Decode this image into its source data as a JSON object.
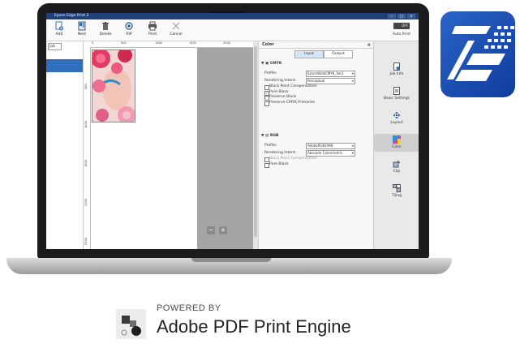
{
  "window": {
    "title": "Epson Edge Print 2",
    "controls": [
      "–",
      "□",
      "×"
    ]
  },
  "toolbar": {
    "buttons": [
      {
        "label": "Add",
        "icon": "add-file-icon"
      },
      {
        "label": "Nest",
        "icon": "nest-icon"
      },
      {
        "label": "Delete",
        "icon": "trash-icon"
      },
      {
        "label": "RIP",
        "icon": "rip-icon"
      },
      {
        "label": "Print",
        "icon": "printer-icon"
      },
      {
        "label": "Cancel",
        "icon": "close-icon"
      }
    ],
    "auto_print": {
      "label": "Auto Print",
      "state": "OFF"
    }
  },
  "job_panel": {
    "field_value": "Job"
  },
  "ruler": {
    "top_ticks": [
      "0",
      "500",
      "1000",
      "1500",
      "2000"
    ],
    "left_ticks": [
      "500",
      "1000",
      "1500",
      "2000",
      "2500"
    ]
  },
  "zoom": {
    "out": "−",
    "in": "+"
  },
  "color_panel": {
    "title": "Color",
    "tabs": {
      "input": "Input",
      "output": "Output"
    },
    "cmyk": {
      "heading": "CMYK",
      "profile_label": "Profile:",
      "profile_value": "EpsonWideCMYK_Ver2",
      "intent_label": "Rendering Intent:",
      "intent_value": "Perceptual",
      "checks": [
        {
          "label": "Black Point Compensation",
          "checked": false,
          "disabled": false
        },
        {
          "label": "Pure Black",
          "checked": true,
          "disabled": false
        },
        {
          "label": "Preserve Black",
          "checked": false,
          "disabled": false
        },
        {
          "label": "Preserve CMYK Primaries",
          "checked": false,
          "disabled": false
        }
      ]
    },
    "rgb": {
      "heading": "RGB",
      "profile_label": "Profile:",
      "profile_value": "AdobeRGB1998",
      "intent_label": "Rendering Intent:",
      "intent_value": "Absolute Colorimetric",
      "checks": [
        {
          "label": "Black Point Compensation",
          "checked": false,
          "disabled": true
        },
        {
          "label": "Pure Black",
          "checked": false,
          "disabled": false
        }
      ]
    }
  },
  "sidebar": {
    "items": [
      {
        "label": "Job Info",
        "icon": "job-info-icon"
      },
      {
        "label": "Basic Settings",
        "icon": "basic-settings-icon"
      },
      {
        "label": "Layout",
        "icon": "layout-icon"
      },
      {
        "label": "Color",
        "icon": "color-icon",
        "active": true
      },
      {
        "label": "Clip",
        "icon": "clip-icon"
      },
      {
        "label": "Tiling",
        "icon": "tiling-icon"
      }
    ]
  },
  "powered_by": {
    "small": "POWERED BY",
    "big": "Adobe PDF Print Engine"
  },
  "colors": {
    "titlebar": "#1e3f7a",
    "selection": "#2f6fbd",
    "app_tile": "#1a4fb5"
  }
}
